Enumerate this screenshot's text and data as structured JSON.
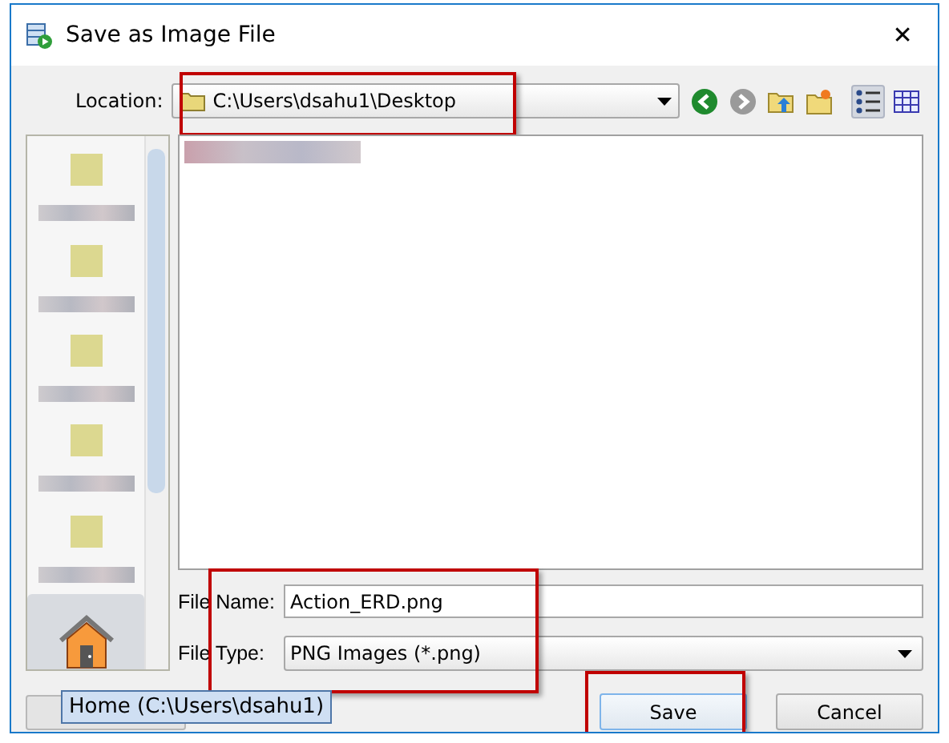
{
  "window": {
    "title": "Save as Image File",
    "close": "✕"
  },
  "location": {
    "label": "Location:",
    "path": "C:\\Users\\dsahu1\\Desktop",
    "highlighted": true
  },
  "toolbar": [
    {
      "kind": "back",
      "disabled": false,
      "selected": false
    },
    {
      "kind": "forward",
      "disabled": true,
      "selected": false
    },
    {
      "kind": "up",
      "selected": false
    },
    {
      "kind": "new-folder",
      "selected": false
    },
    {
      "kind": "list-view",
      "selected": true
    },
    {
      "kind": "details-view",
      "selected": false
    }
  ],
  "sidebar": {
    "items": [
      {
        "kind": "folder",
        "selected": false
      },
      {
        "kind": "folder",
        "selected": false
      },
      {
        "kind": "folder",
        "selected": false
      },
      {
        "kind": "folder",
        "selected": false
      },
      {
        "kind": "folder",
        "selected": false
      },
      {
        "kind": "home",
        "selected": true
      }
    ]
  },
  "form": {
    "highlighted": true,
    "file_name": {
      "label": "File Name:",
      "value": "Action_ERD.png"
    },
    "file_type": {
      "label": "File Type:",
      "value": "PNG Images (*.png)"
    }
  },
  "tooltip": "Home (C:\\Users\\dsahu1)",
  "buttons": [
    {
      "label": "Save",
      "focused": true,
      "highlighted": true
    },
    {
      "label": "Cancel",
      "focused": false,
      "highlighted": false
    }
  ]
}
